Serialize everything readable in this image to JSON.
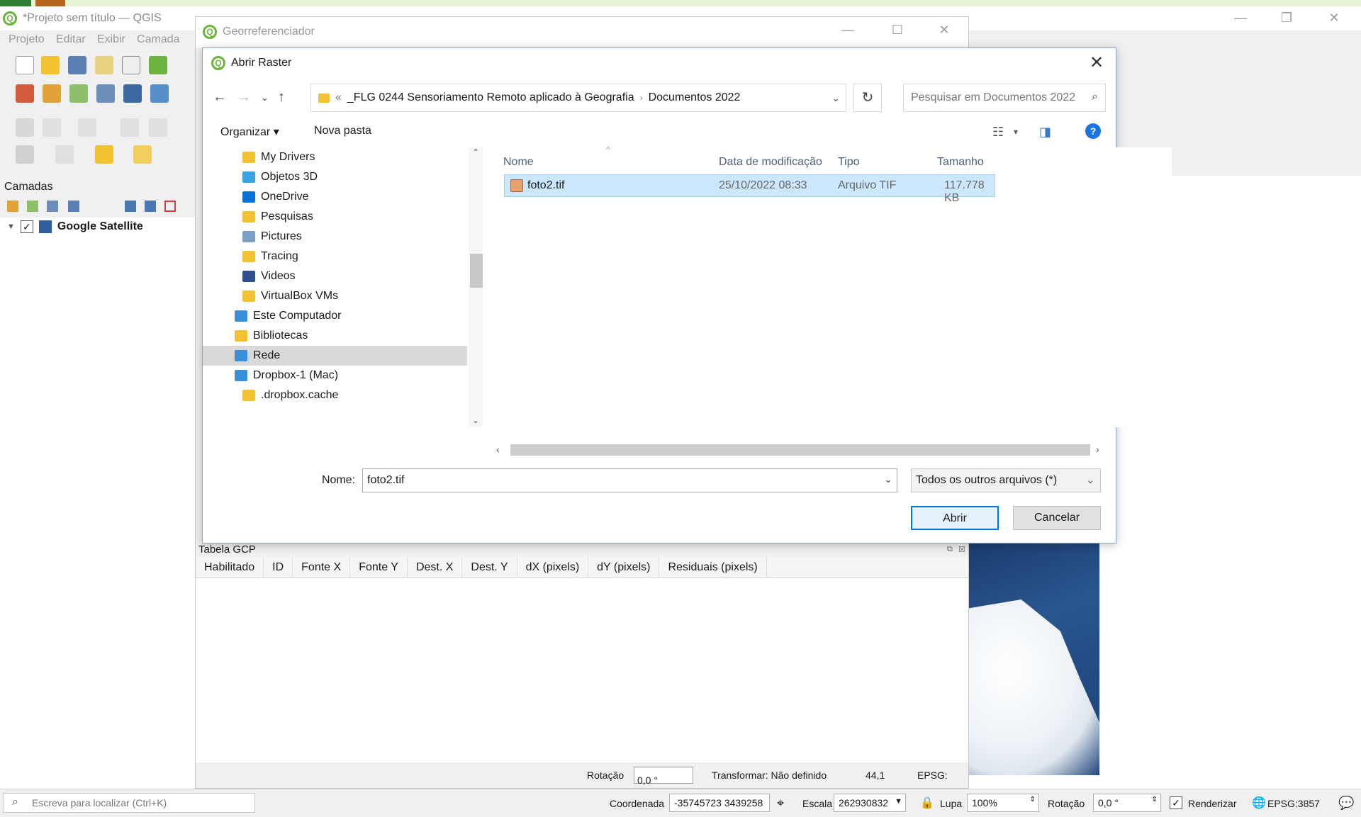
{
  "qgis": {
    "title": "*Projeto sem título — QGIS",
    "menu": [
      "Projeto",
      "Editar",
      "Exibir",
      "Camada"
    ],
    "layers_panel_title": "Camadas",
    "layer_name": "Google Satellite",
    "layer_checked": "✓"
  },
  "georef": {
    "title": "Georreferenciador",
    "gcp_title": "Tabela GCP",
    "gcp_columns": [
      "Habilitado",
      "ID",
      "Fonte X",
      "Fonte Y",
      "Dest. X",
      "Dest. Y",
      "dX (pixels)",
      "dY (pixels)",
      "Residuais (pixels)"
    ],
    "status": {
      "rotation_label": "Rotação",
      "rotation_value": "0,0 °",
      "transform": "Transformar: Não definido",
      "value": "44,1",
      "epsg_label": "EPSG:"
    }
  },
  "dialog": {
    "title": "Abrir Raster",
    "breadcrumb_prefix": "«",
    "breadcrumb": [
      "_FLG 0244 Sensoriamento Remoto aplicado à Geografia",
      "Documentos 2022"
    ],
    "search_placeholder": "Pesquisar em Documentos 2022",
    "organize": "Organizar ▾",
    "new_folder": "Nova pasta",
    "nav_items": [
      {
        "label": "My Drivers",
        "color": "#f1c232"
      },
      {
        "label": "Objetos 3D",
        "color": "#3aa3e3"
      },
      {
        "label": "OneDrive",
        "color": "#0a74d6"
      },
      {
        "label": "Pesquisas",
        "color": "#f1c232"
      },
      {
        "label": "Pictures",
        "color": "#7aa0c8"
      },
      {
        "label": "Tracing",
        "color": "#f1c232"
      },
      {
        "label": "Videos",
        "color": "#2f4f8f"
      },
      {
        "label": "VirtualBox VMs",
        "color": "#f1c232"
      },
      {
        "label": "Este Computador",
        "color": "#3a8fd8"
      },
      {
        "label": "Bibliotecas",
        "color": "#f1c232"
      },
      {
        "label": "Rede",
        "color": "#3a8fd8"
      },
      {
        "label": "Dropbox-1 (Mac)",
        "color": "#3a8fd8"
      },
      {
        "label": ".dropbox.cache",
        "color": "#f1c232"
      }
    ],
    "columns": {
      "name": "Nome",
      "modified": "Data de modificação",
      "type": "Tipo",
      "size": "Tamanho"
    },
    "files": [
      {
        "name": "foto2.tif",
        "modified": "25/10/2022 08:33",
        "type": "Arquivo TIF",
        "size": "117.778 KB"
      }
    ],
    "filename_label": "Nome:",
    "filename_value": "foto2.tif",
    "filter_value": "Todos os outros arquivos (*)",
    "open_button": "Abrir",
    "cancel_button": "Cancelar"
  },
  "statusbar": {
    "locator_placeholder": "Escreva para localizar (Ctrl+K)",
    "coord_label": "Coordenada",
    "coord_value": "-35745723 3439258",
    "scale_label": "Escala",
    "scale_value": "262930832",
    "magnifier_label": "Lupa",
    "magnifier_value": "100%",
    "rotation_label": "Rotação",
    "rotation_value": "0,0 °",
    "render_label": "Renderizar",
    "crs": "EPSG:3857"
  }
}
